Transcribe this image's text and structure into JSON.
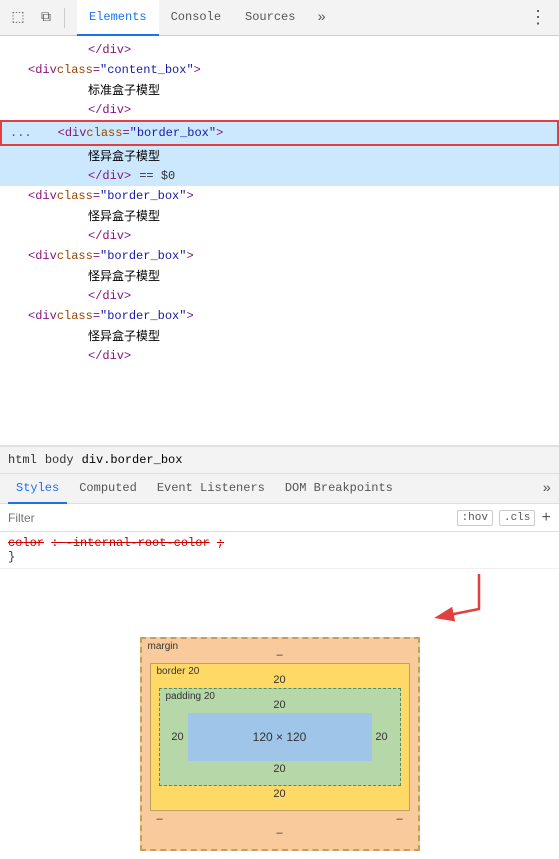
{
  "tabs": {
    "icons": [
      "⬚",
      "⧉"
    ],
    "items": [
      {
        "label": "Elements",
        "active": true
      },
      {
        "label": "Console",
        "active": false
      },
      {
        "label": "Sources",
        "active": false
      }
    ],
    "more_label": "»",
    "menu_label": "⋮"
  },
  "elements": {
    "lines": [
      {
        "indent": 60,
        "content": "</div>",
        "type": "close-tag",
        "selected": false,
        "ellipsis": false
      },
      {
        "indent": 20,
        "class_val": "content_box",
        "text": "标准盒子模型",
        "selected": false,
        "has_ellipsis": false
      },
      {
        "indent": 60,
        "content": "</div>",
        "type": "close-tag",
        "selected": false,
        "ellipsis": false
      },
      {
        "indent": 20,
        "class_val": "border_box",
        "text": "怪异盒子模型",
        "selected": true,
        "has_ellipsis": true,
        "dollar_zero": true
      },
      {
        "indent": 20,
        "class_val": "border_box",
        "text": "怪异盒子模型",
        "selected": false,
        "has_ellipsis": false
      },
      {
        "indent": 60,
        "content": "</div>",
        "type": "close-tag",
        "selected": false,
        "ellipsis": false
      },
      {
        "indent": 20,
        "class_val": "border_box",
        "text": "怪异盒子模型",
        "selected": false,
        "has_ellipsis": false
      },
      {
        "indent": 60,
        "content": "</div>",
        "type": "close-tag",
        "selected": false,
        "ellipsis": false
      },
      {
        "indent": 20,
        "class_val": "border_box",
        "text": "怪异盒子模型",
        "selected": false,
        "has_ellipsis": false
      },
      {
        "indent": 60,
        "content": "</div>",
        "type": "close-tag",
        "selected": false,
        "ellipsis": false
      }
    ]
  },
  "breadcrumb": {
    "items": [
      "html",
      "body",
      "div.border_box"
    ]
  },
  "panel_tabs": {
    "items": [
      {
        "label": "Styles",
        "active": true
      },
      {
        "label": "Computed",
        "active": false
      },
      {
        "label": "Event Listeners",
        "active": false
      },
      {
        "label": "DOM Breakpoints",
        "active": false
      }
    ],
    "more": "»"
  },
  "filter": {
    "placeholder": "Filter",
    "hov_label": ":hov",
    "cls_label": ".cls",
    "plus_label": "+"
  },
  "css_rule": {
    "property": "color",
    "value": "-internal-root-color",
    "closing_brace": "}"
  },
  "box_model": {
    "margin_label": "margin",
    "margin_dash": "–",
    "border_label": "border",
    "border_value": "20",
    "padding_label": "padding",
    "padding_value": "20",
    "content_label": "120 × 120",
    "side_values": {
      "top": "20",
      "right": "20",
      "bottom": "20",
      "left": "20"
    },
    "margin_sides": {
      "left": "–",
      "right": "–",
      "top": "–",
      "bottom": "–"
    }
  },
  "colors": {
    "tab_active": "#1a73e8",
    "selected_bg": "#cce8ff",
    "selected_border": "#e04040",
    "margin_bg": "#f9cb9c",
    "border_bg": "#ffd966",
    "padding_bg": "#b6d7a8",
    "content_bg": "#9fc5e8",
    "arrow_color": "#e04040"
  }
}
